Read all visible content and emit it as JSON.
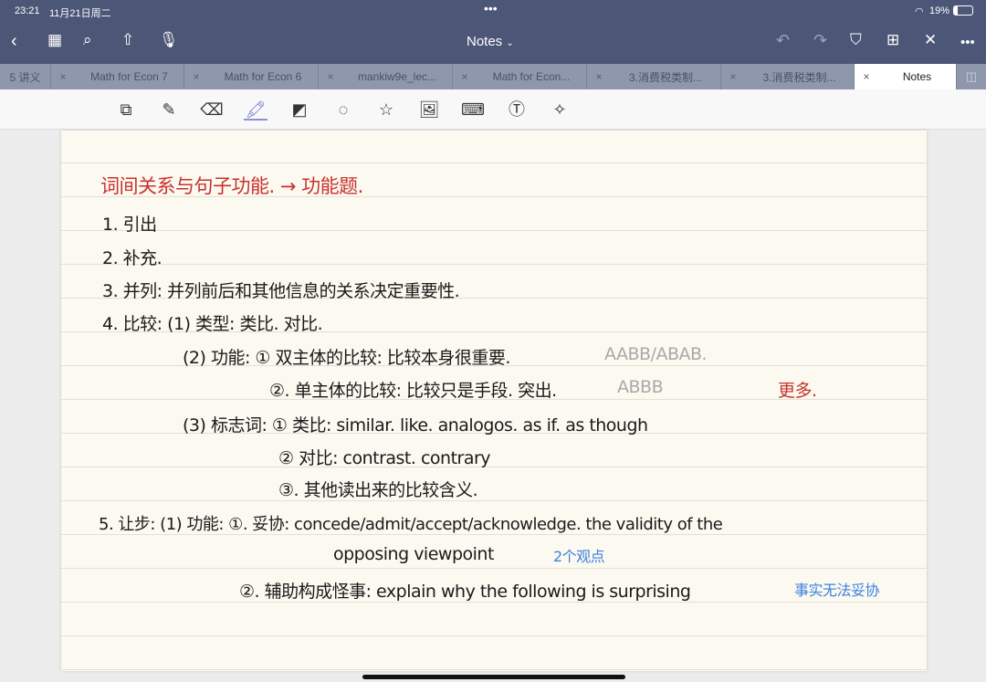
{
  "status": {
    "time": "23:21",
    "date": "11月21日周二",
    "battery": "19%"
  },
  "header": {
    "title": "Notes",
    "icons": [
      "back-icon",
      "grid-icon",
      "search-icon",
      "share-icon",
      "microphone-icon",
      "undo-icon",
      "redo-icon",
      "bookmark-icon",
      "add-page-icon",
      "close-icon",
      "more-icon"
    ]
  },
  "tabs": [
    {
      "label": "5 讲义"
    },
    {
      "label": "Math for Econ 7"
    },
    {
      "label": "Math for Econ 6"
    },
    {
      "label": "mankiw9e_lec..."
    },
    {
      "label": "Math for Econ..."
    },
    {
      "label": "3.消费税类制..."
    },
    {
      "label": "3.消费税类制..."
    },
    {
      "label": "Notes",
      "active": true
    }
  ],
  "toolbar": {
    "tools": [
      "zoom-window-icon",
      "pen-icon",
      "eraser-icon",
      "highlighter-icon",
      "shapes-icon",
      "lasso-icon",
      "sticker-icon",
      "image-icon",
      "keyboard-icon",
      "text-icon",
      "laser-pointer-icon"
    ],
    "colors": [
      "#3a3a3a",
      "#3a3a3a",
      "#3a3a3a",
      "#e88ad6",
      "#8b8ff0",
      "#f4cfa8"
    ],
    "selected_color_index": 2
  },
  "notes": {
    "title": "词间关系与句子功能. → 功能题.",
    "l1": "1. 引出",
    "l2": "2. 补充.",
    "l3": "3. 并列: 并列前后和其他信息的关系决定重要性.",
    "l4": "4. 比较: (1) 类型: 类比. 对比.",
    "l5": "(2) 功能: ① 双主体的比较: 比较本身很重要.",
    "l5b": "AABB/ABAB.",
    "l6": "②. 单主体的比较: 比较只是手段. 突出.",
    "l6b": "ABBB",
    "l6c": "更多.",
    "l7": "(3) 标志词: ① 类比: similar. like. analogos. as if. as though",
    "l8": "② 对比: contrast. contrary",
    "l9": "③. 其他读出来的比较含义.",
    "l10": "5. 让步: (1) 功能: ①. 妥协: concede/admit/accept/acknowledge. the validity of the",
    "l11": "opposing viewpoint",
    "l11b": "2个观点",
    "l12": "②. 辅助构成怪事: explain why the following is surprising",
    "l12b": "事实无法妥协"
  }
}
